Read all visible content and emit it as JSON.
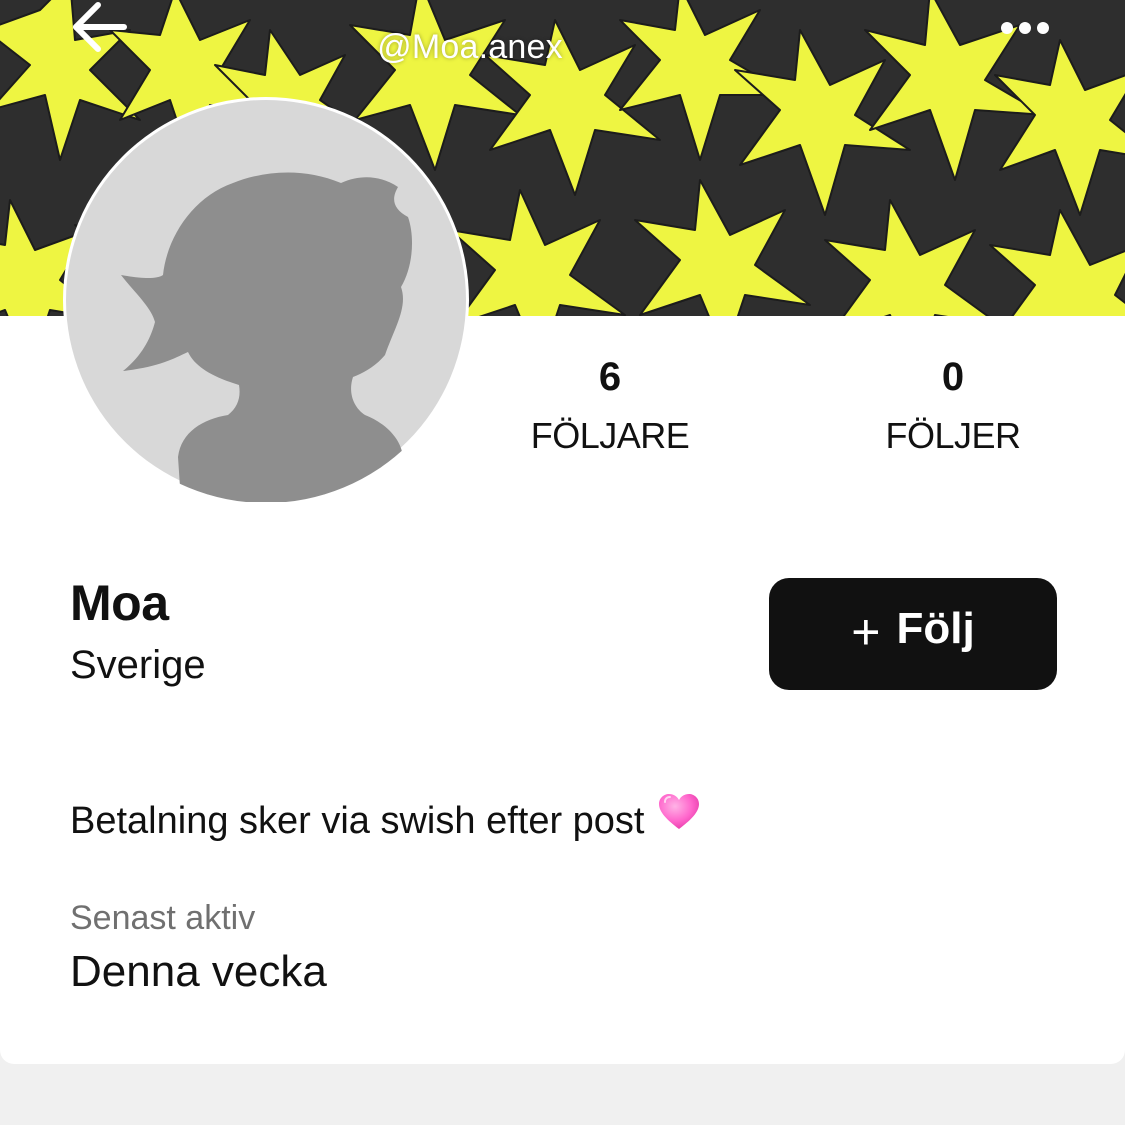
{
  "header": {
    "handle": "@Moa.anex",
    "back_icon": "arrow-left-icon",
    "more_icon": "more-horizontal-icon"
  },
  "cover": {
    "pattern": "yellow-stars-on-dark",
    "colors": {
      "background": "#2e2e2e",
      "stars": "#eef542"
    }
  },
  "profile": {
    "avatar_icon": "default-avatar-silhouette",
    "name": "Moa",
    "location": "Sverige",
    "bio": "Betalning sker via swish efter post",
    "bio_emoji": "growing-heart-icon",
    "last_active_label": "Senast aktiv",
    "last_active_value": "Denna vecka"
  },
  "stats": {
    "followers_count": "6",
    "followers_label": "FÖLJARE",
    "following_count": "0",
    "following_label": "FÖLJER"
  },
  "actions": {
    "follow_plus": "+",
    "follow_label": "Följ"
  },
  "theme": {
    "button_bg": "#111111",
    "text": "#111111",
    "muted_text": "#707070",
    "page_bg": "#f0f0f0"
  }
}
